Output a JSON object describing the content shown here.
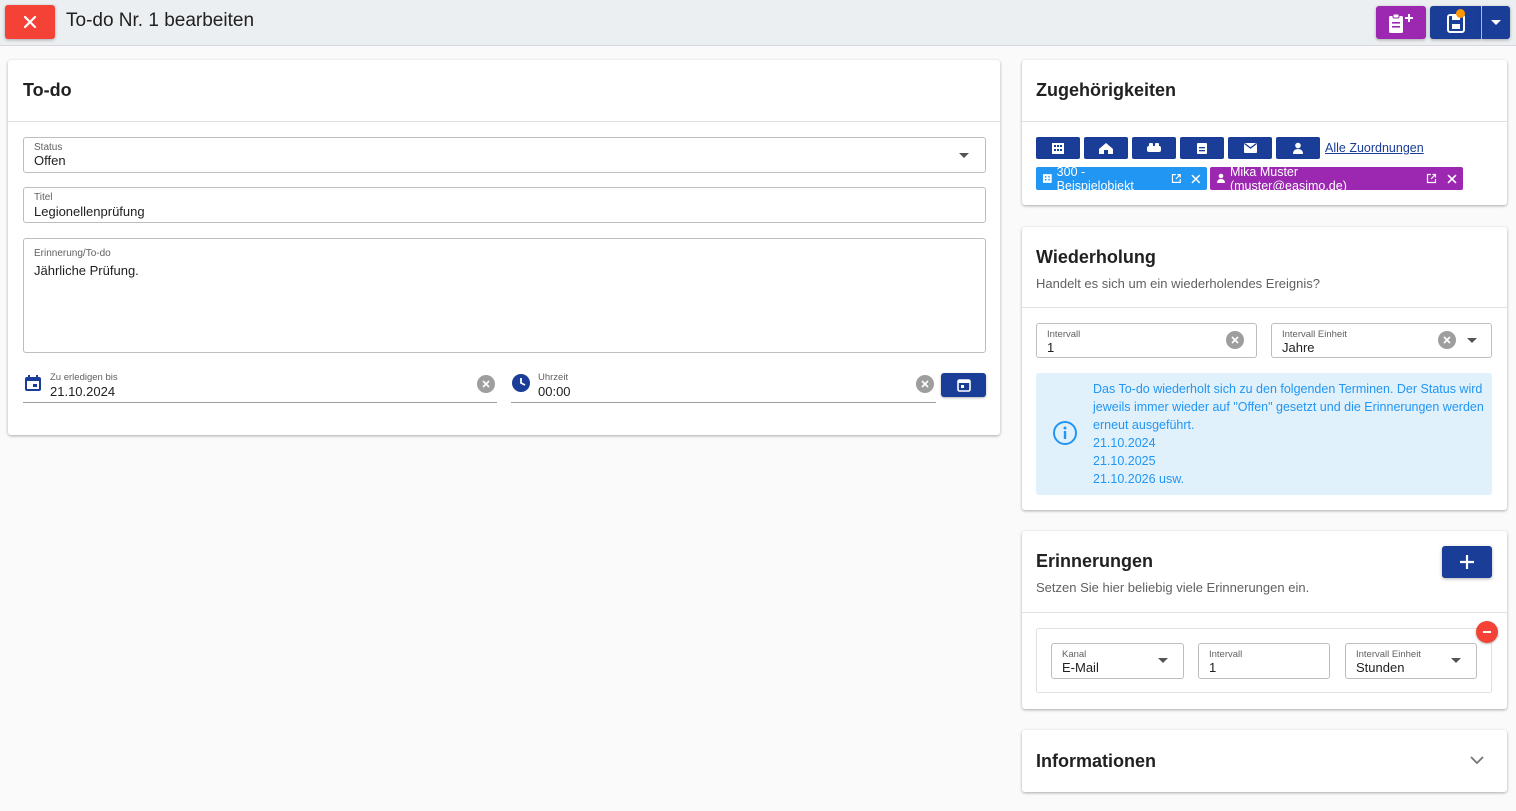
{
  "header": {
    "title": "To-do Nr. 1 bearbeiten"
  },
  "todo": {
    "card_title": "To-do",
    "status": {
      "label": "Status",
      "value": "Offen"
    },
    "title_field": {
      "label": "Titel",
      "value": "Legionellenprüfung"
    },
    "reminder": {
      "label": "Erinnerung/To-do",
      "value": "Jährliche Prüfung."
    },
    "due_date": {
      "label": "Zu erledigen bis",
      "value": "21.10.2024"
    },
    "time": {
      "label": "Uhrzeit",
      "value": "00:00"
    }
  },
  "associations": {
    "card_title": "Zugehörigkeiten",
    "buttons": [
      "building-icon",
      "house-icon",
      "group-icon",
      "clipboard-icon",
      "mail-icon",
      "person-icon"
    ],
    "all_link": "Alle Zuordnungen",
    "chips": [
      {
        "label": "300 - Beispielobjekt",
        "color": "#2196f3"
      },
      {
        "label": "Mika Muster (muster@easimo.de)",
        "color": "#9c27b0"
      }
    ]
  },
  "repeat": {
    "card_title": "Wiederholung",
    "subtitle": "Handelt es sich um ein wiederholendes Ereignis?",
    "interval": {
      "label": "Intervall",
      "value": "1"
    },
    "unit": {
      "label": "Intervall Einheit",
      "value": "Jahre"
    },
    "info_lines": [
      "Das To-do wiederholt sich zu den folgenden Terminen. Der Status wird jeweils immer wieder auf \"Offen\" gesetzt und die Erinnerungen werden erneut ausgeführt.",
      "21.10.2024",
      "21.10.2025",
      "21.10.2026 usw."
    ]
  },
  "reminders": {
    "card_title": "Erinnerungen",
    "subtitle": "Setzen Sie hier beliebig viele Erinnerungen ein.",
    "item": {
      "channel": {
        "label": "Kanal",
        "value": "E-Mail"
      },
      "interval": {
        "label": "Intervall",
        "value": "1"
      },
      "unit": {
        "label": "Intervall Einheit",
        "value": "Stunden"
      }
    }
  },
  "info": {
    "card_title": "Informationen"
  },
  "colors": {
    "primary": "#1a3d97",
    "danger": "#f44336",
    "purple": "#9c27b0",
    "info_blue": "#2196f3"
  }
}
